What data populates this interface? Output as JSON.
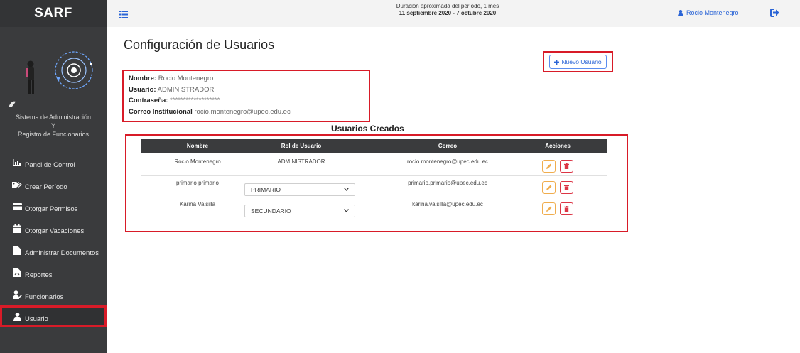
{
  "brand": "SARF",
  "sidebar": {
    "system_title_line1": "Sistema de Administración",
    "system_title_line2": "Y",
    "system_title_line3": "Registro de Funcionarios",
    "items": [
      {
        "label": "Panel de Control",
        "icon": "chart-icon"
      },
      {
        "label": "Crear Período",
        "icon": "tags-icon"
      },
      {
        "label": "Otorgar Permisos",
        "icon": "card-icon"
      },
      {
        "label": "Otorgar Vacaciones",
        "icon": "calendar-icon"
      },
      {
        "label": "Administrar Documentos",
        "icon": "file-icon"
      },
      {
        "label": "Reportes",
        "icon": "pdf-icon"
      },
      {
        "label": "Funcionarios",
        "icon": "user-edit-icon"
      },
      {
        "label": "Usuario",
        "icon": "user-icon",
        "active": true
      }
    ]
  },
  "topbar": {
    "period_line1": "Duración aproximada del período, 1 mes",
    "period_line2": "11 septiembre 2020 - 7 octubre 2020",
    "user_name": "Rocio Montenegro"
  },
  "page": {
    "title": "Configuración de Usuarios",
    "new_user_label": "Nuevo Usuario"
  },
  "profile": {
    "name_label": "Nombre:",
    "name_value": "Rocio Montenegro",
    "user_label": "Usuario:",
    "user_value": "ADMINISTRADOR",
    "password_label": "Contraseña:",
    "password_value": "*******************",
    "email_label": "Correo Institucional",
    "email_value": "rocio.montenegro@upec.edu.ec"
  },
  "users_table": {
    "title": "Usuarios Creados",
    "headers": [
      "Nombre",
      "Rol de Usuario",
      "Correo",
      "Acciones"
    ],
    "rows": [
      {
        "name": "Rocio Montenegro",
        "role": "ADMINISTRADOR",
        "email": "rocio.montenegro@upec.edu.ec",
        "role_is_select": false
      },
      {
        "name": "primario primario",
        "role": "PRIMARIO",
        "email": "primario.primario@upec.edu.ec",
        "role_is_select": true
      },
      {
        "name": "Karina Vaisilla",
        "role": "SECUNDARIO",
        "email": "karina.vaisilla@upec.edu.ec",
        "role_is_select": true
      }
    ]
  },
  "colors": {
    "sidebar_bg": "#3a3b3d",
    "accent_blue": "#2a64d6",
    "highlight_red": "#d81b28",
    "edit_yellow": "#f0ad4e",
    "delete_red": "#dc3545"
  }
}
